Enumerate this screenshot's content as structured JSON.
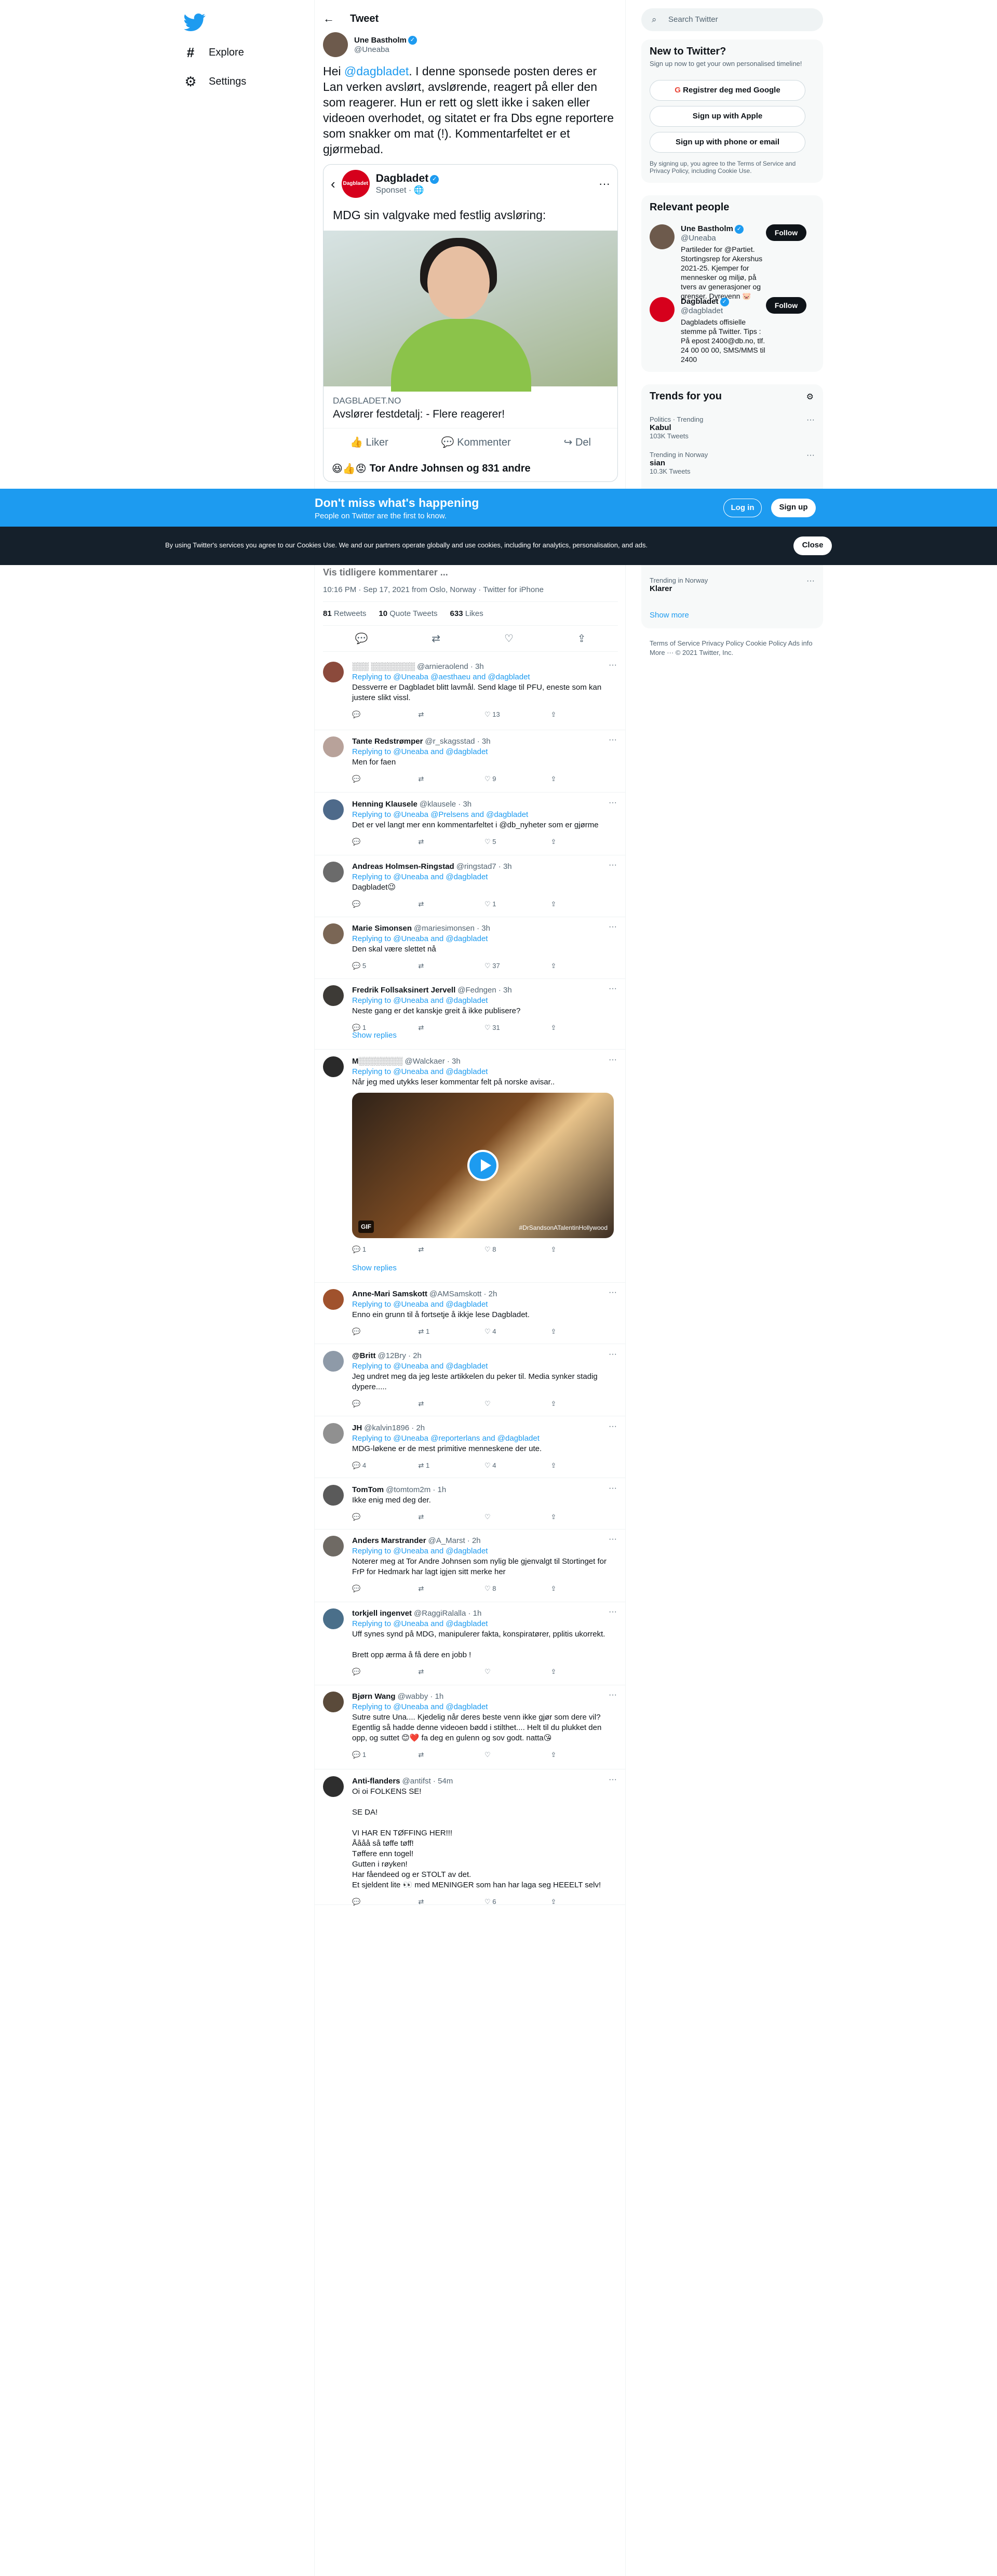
{
  "nav": {
    "explore": "Explore",
    "settings": "Settings"
  },
  "header": {
    "title": "Tweet"
  },
  "tweet": {
    "author_name": "Une Bastholm",
    "author_handle": "@Uneaba",
    "text_pre": "Hei ",
    "text_mention": "@dagbladet",
    "text_post": ". I denne sponsede posten deres er Lan verken avslørt, avslørende, reagert på eller den som reagerer. Hun er rett og slett ikke i saken eller videoen overhodet, og sitatet er fra Dbs egne reportere som snakker om mat (!). Kommentarfeltet er et gjørmebad.",
    "card": {
      "brand": "Dagbladet",
      "sponsored": "Sponset ·",
      "text": "MDG sin valgvake med festlig avsløring:",
      "domain": "DAGBLADET.NO",
      "headline": "Avslører festdetalj: - Flere reagerer!",
      "like": "Liker",
      "comment": "Kommenter",
      "share": "Del",
      "reactions": "Tor Andre Johnsen og 831 andre"
    },
    "hidden_line": "Vis tidligere kommentarer ...",
    "meta": "10:16 PM · Sep 17, 2021 from Oslo, Norway · Twitter for iPhone",
    "retweets_n": "81",
    "retweets_label": "Retweets",
    "quotes_n": "10",
    "quotes_label": "Quote Tweets",
    "likes_n": "633",
    "likes_label": "Likes"
  },
  "banner": {
    "title": "Don't miss what's happening",
    "subtitle": "People on Twitter are the first to know.",
    "login": "Log in",
    "signup": "Sign up"
  },
  "cookie": {
    "text": "By using Twitter's services you agree to our Cookies Use. We and our partners operate globally and use cookies, including for analytics, personalisation, and ads.",
    "close": "Close"
  },
  "replies": [
    {
      "name": "░░░ ░░░░░░░░",
      "handle": "@arnieraolend · 3h",
      "replying": "Replying to @Uneaba @aesthaeu and @dagbladet",
      "text": "Dessverre er Dagbladet blitt lavmål. Send klage til PFU, eneste som kan justere slikt vissl.",
      "replies": "",
      "rts": "",
      "likes": "13",
      "color": "#8b4a3c"
    },
    {
      "name": "Tante Redstrømper",
      "handle": "@r_skagsstad · 3h",
      "replying": "Replying to @Uneaba and @dagbladet",
      "text": "Men for faen",
      "replies": "",
      "rts": "",
      "likes": "9",
      "color": "#b8a29a"
    },
    {
      "name": "Henning Klausele",
      "handle": "@klausele · 3h",
      "replying": "Replying to @Uneaba @Prelsens and @dagbladet",
      "text": "Det er vel langt mer enn kommentarfeltet i @db_nyheter som er gjørme",
      "replies": "",
      "rts": "",
      "likes": "5",
      "color": "#4e6a8a"
    },
    {
      "name": "Andreas Holmsen-Ringstad",
      "handle": "@ringstad7 · 3h",
      "replying": "Replying to @Uneaba and @dagbladet",
      "text": "Dagbladet😉",
      "replies": "",
      "rts": "",
      "likes": "1",
      "color": "#6b6b6b"
    },
    {
      "name": "Marie Simonsen",
      "handle": "@mariesimonsen · 3h",
      "replying": "Replying to @Uneaba and @dagbladet",
      "text": "Den skal være slettet nå",
      "replies": "5",
      "rts": "",
      "likes": "37",
      "color": "#7a6655"
    },
    {
      "name": "Fredrik Follsaksinert Jervell",
      "handle": "@Fedngen · 3h",
      "replying": "Replying to @Uneaba and @dagbladet",
      "text": "Neste gang er det kanskje greit å ikke publisere?",
      "replies": "1",
      "rts": "",
      "likes": "31",
      "color": "#3d3a36"
    },
    {
      "name": "M░░░░░░░░",
      "handle": "@Walckaer · 3h",
      "replying": "Replying to @Uneaba and @dagbladet",
      "text": "Når jeg med utykks leser kommentar felt på norske avisar..",
      "replies": "1",
      "rts": "",
      "likes": "8",
      "color": "#2a2a2a",
      "gif": "GIF",
      "video_tag": "#DrSandsonATalentinHollywood"
    },
    {
      "name": "Anne-Mari Samskott",
      "handle": "@AMSamskott · 2h",
      "replying": "Replying to @Uneaba and @dagbladet",
      "text": "Enno ein grunn til å fortsetje å ikkje lese Dagbladet.",
      "replies": "",
      "rts": "1",
      "likes": "4",
      "color": "#a0522d"
    },
    {
      "name": "@Britt",
      "handle": "@12Bry · 2h",
      "replying": "Replying to @Uneaba and @dagbladet",
      "text": "Jeg undret meg da jeg leste artikkelen du peker til. Media synker stadig dypere.....",
      "replies": "",
      "rts": "",
      "likes": "",
      "color": "#8e9aa8"
    },
    {
      "name": "JH",
      "handle": "@kalvin1896 · 2h",
      "replying": "Replying to @Uneaba @reporterlans and @dagbladet",
      "text": "MDG-løkene er de mest primitive menneskene der ute.",
      "replies": "4",
      "rts": "1",
      "likes": "4",
      "color": "#909090"
    },
    {
      "name": "TomTom",
      "handle": "@tomtom2m · 1h",
      "replying": "",
      "text": "Ikke enig med deg der.",
      "replies": "",
      "rts": "",
      "likes": "",
      "color": "#5a5a5a"
    },
    {
      "name": "Anders Marstrander",
      "handle": "@A_Marst · 2h",
      "replying": "Replying to @Uneaba and @dagbladet",
      "text": "Noterer meg at Tor Andre Johnsen som nylig ble gjenvalgt til Stortinget for FrP for Hedmark har lagt igjen sitt merke her",
      "replies": "",
      "rts": "",
      "likes": "8",
      "color": "#6f6a64"
    },
    {
      "name": "torkjell ingenvet",
      "handle": "@RaggiRalalla · 1h",
      "replying": "Replying to @Uneaba and @dagbladet",
      "text": "Uff synes synd på MDG, manipulerer fakta, konspiratører, pplitis ukorrekt.\n\nBrett opp ærma å få dere en jobb !",
      "replies": "",
      "rts": "",
      "likes": "",
      "color": "#4a6f8a"
    },
    {
      "name": "Bjørn Wang",
      "handle": "@wabby · 1h",
      "replying": "Replying to @Uneaba and @dagbladet",
      "text": "Sutre sutre Una.... Kjedelig når deres beste venn ikke gjør som dere vil? Egentlig så hadde denne videoen bødd i stilthet.... Helt til du plukket den opp, og suttet 😊❤️ fa deg en gulenn og sov godt. natta😘",
      "replies": "1",
      "rts": "",
      "likes": "",
      "color": "#5a4a3a"
    },
    {
      "name": "Anti-flanders",
      "handle": "@antifst · 54m",
      "replying": "",
      "text": "Oi oi FOLKENS SE!\n\nSE DA!\n\nVI HAR EN TØFFING HER!!!\nÅååå så tøffe tøff!\nTøffere enn togel!\nGutten i røyken!\nHar fåendeed og er STOLT av det.\nEt sjeldent lite 👀 med MENINGER som han har laga seg HEEELT selv!",
      "replies": "",
      "rts": "",
      "likes": "6",
      "color": "#2e2e2e"
    }
  ],
  "show_replies": "Show replies",
  "right": {
    "search_placeholder": "Search Twitter",
    "new_title": "New to Twitter?",
    "new_sub": "Sign up now to get your own personalised timeline!",
    "google": "Registrer deg med Google",
    "apple": "Sign up with Apple",
    "phone": "Sign up with phone or email",
    "terms": "By signing up, you agree to the Terms of Service and Privacy Policy, including Cookie Use.",
    "relevant_title": "Relevant people",
    "people": [
      {
        "name": "Une Bastholm",
        "handle": "@Uneaba",
        "bio": "Partileder for @Partiet. Stortingsrep for Akershus 2021-25. Kjemper for mennesker og miljø, på tvers av generasjoner og grenser. Dyrevenn 🐷",
        "follow": "Follow"
      },
      {
        "name": "Dagbladet",
        "handle": "@dagbladet",
        "bio": "Dagbladets offisielle stemme på Twitter. Tips : På epost 2400@db.no, tlf. 24 00 00 00, SMS/MMS til 2400",
        "follow": "Follow"
      }
    ],
    "trends_title": "Trends for you",
    "trends": [
      {
        "meta": "Politics · Trending",
        "name": "Kabul",
        "count": "103K Tweets"
      },
      {
        "meta": "Trending in Norway",
        "name": "sian",
        "count": "10.3K Tweets"
      },
      {
        "meta": "Trending in Norway",
        "name": "Klarer",
        "count": ""
      }
    ],
    "show_more": "Show more",
    "footer": "Terms of Service   Privacy Policy   Cookie Policy   Ads info   More ···   © 2021 Twitter, Inc."
  }
}
